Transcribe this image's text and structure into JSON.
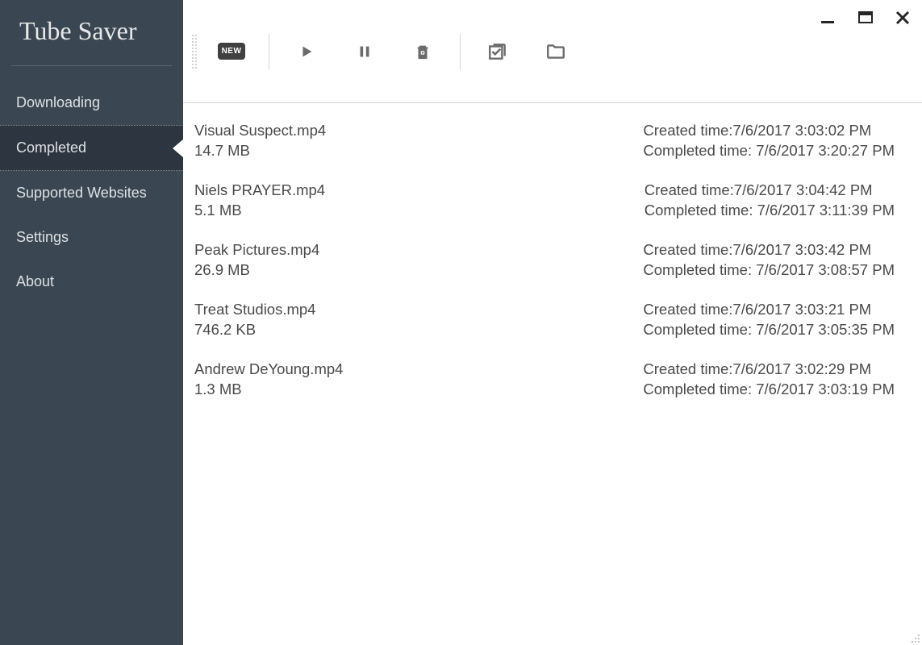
{
  "app": {
    "title": "Tube Saver"
  },
  "sidebar": {
    "items": [
      {
        "label": "Downloading",
        "active": false
      },
      {
        "label": "Completed",
        "active": true
      },
      {
        "label": "Supported Websites",
        "active": false
      },
      {
        "label": "Settings",
        "active": false
      },
      {
        "label": "About",
        "active": false
      }
    ]
  },
  "toolbar": {
    "new_label": "NEW"
  },
  "downloads": [
    {
      "filename": "Visual Suspect.mp4",
      "size": "14.7 MB",
      "created_label": "Created time:7/6/2017 3:03:02 PM",
      "completed_label": "Completed time: 7/6/2017 3:20:27 PM"
    },
    {
      "filename": "Niels PRAYER.mp4",
      "size": "5.1 MB",
      "created_label": "Created time:7/6/2017 3:04:42 PM",
      "completed_label": "Completed time: 7/6/2017 3:11:39 PM"
    },
    {
      "filename": "Peak Pictures.mp4",
      "size": "26.9 MB",
      "created_label": "Created time:7/6/2017 3:03:42 PM",
      "completed_label": "Completed time: 7/6/2017 3:08:57 PM"
    },
    {
      "filename": "Treat Studios.mp4",
      "size": "746.2 KB",
      "created_label": "Created time:7/6/2017 3:03:21 PM",
      "completed_label": "Completed time: 7/6/2017 3:05:35 PM"
    },
    {
      "filename": "Andrew DeYoung.mp4",
      "size": "1.3 MB",
      "created_label": "Created time:7/6/2017 3:02:29 PM",
      "completed_label": "Completed time: 7/6/2017 3:03:19 PM"
    }
  ]
}
